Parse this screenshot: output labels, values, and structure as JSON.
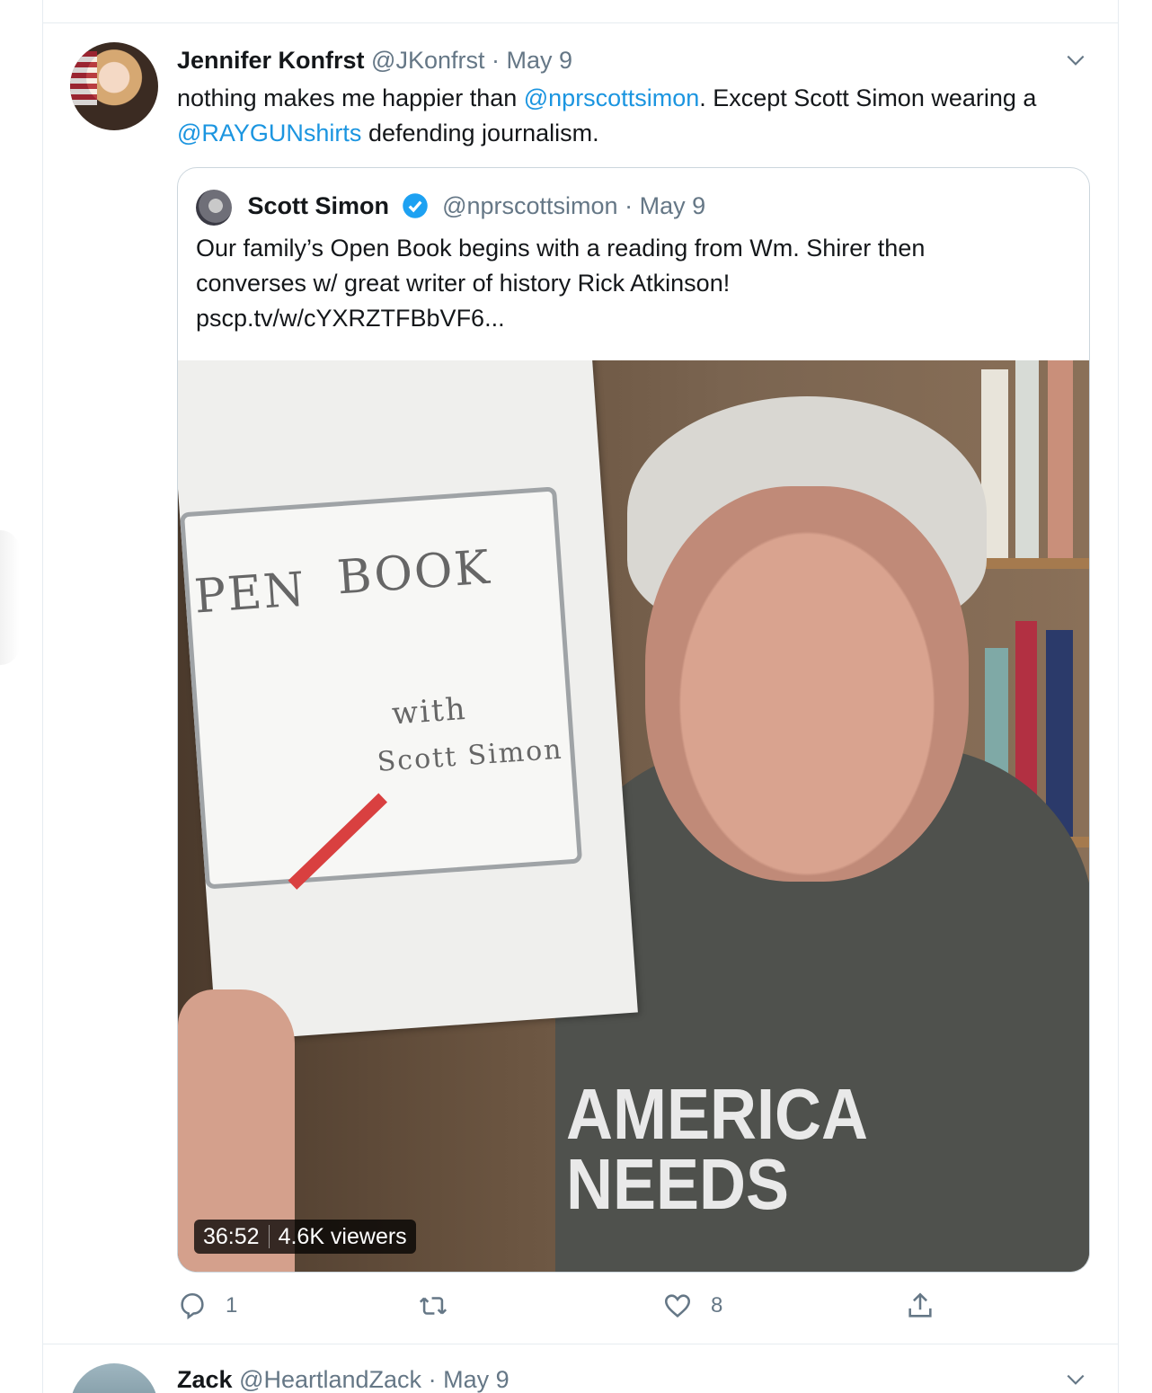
{
  "tweet": {
    "author_name": "Jennifer Konfrst",
    "author_handle": "@JKonfrst",
    "separator": "·",
    "date": "May 9",
    "text_part1": "nothing makes me happier than ",
    "mention1": "@nprscottsimon",
    "text_part2": ". Except Scott Simon wearing a ",
    "mention2": "@RAYGUNshirts",
    "text_part3": " defending journalism.",
    "quote": {
      "author_name": "Scott Simon",
      "author_handle": "@nprscottsimon",
      "separator": "·",
      "date": "May 9",
      "text_line1": "Our family’s Open Book begins with a reading from Wm. Shirer then",
      "text_line2": "converses w/  great writer of history Rick Atkinson!",
      "link": "pscp.tv/w/cYXRZTFBbVF6...",
      "media": {
        "duration": "36:52",
        "viewers": "4.6K viewers",
        "sign_word_left": "PEN",
        "sign_word_right": "BOOK",
        "sign_with": "with",
        "sign_name": "Scott Simon",
        "shirt_line1": "AMERICA",
        "shirt_line2": "NEEDS"
      }
    },
    "actions": {
      "reply_count": "1",
      "retweet_count": "",
      "like_count": "8"
    }
  },
  "next_tweet": {
    "author_name": "Zack",
    "author_handle": "@HeartlandZack",
    "separator": "·",
    "date": "May 9"
  },
  "colors": {
    "link": "#1b95e0",
    "secondary_text": "#657786",
    "border": "#e6ecf0",
    "verified": "#1da1f2"
  }
}
